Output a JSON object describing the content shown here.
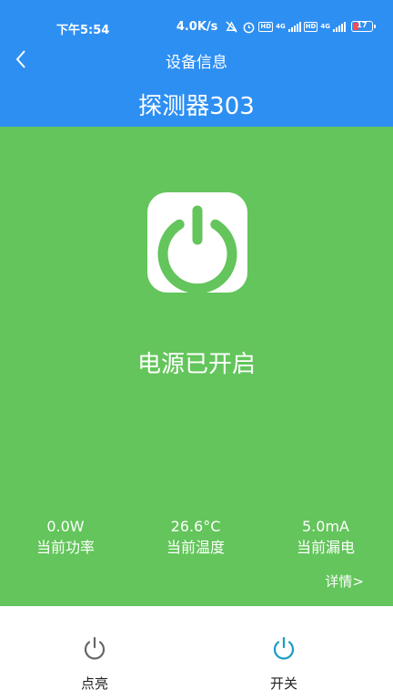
{
  "status_bar": {
    "time": "下午5:54",
    "network_speed": "4.0K/s",
    "battery_level": "17",
    "icons": [
      "mute-icon",
      "alarm-icon",
      "hd-icon",
      "signal-4g-icon",
      "hd-icon",
      "signal-4g-icon",
      "battery-icon"
    ]
  },
  "header": {
    "title": "设备信息",
    "back_icon": "chevron-left-icon"
  },
  "device": {
    "name": "探测器303"
  },
  "power": {
    "icon": "power-icon",
    "status_text": "电源已开启"
  },
  "stats": [
    {
      "value": "0.0W",
      "label": "当前功率"
    },
    {
      "value": "26.6°C",
      "label": "当前温度"
    },
    {
      "value": "5.0mA",
      "label": "当前漏电"
    }
  ],
  "details_link": "详情>",
  "bottom_tabs": [
    {
      "label": "点亮",
      "icon": "power-icon"
    },
    {
      "label": "开关",
      "icon": "power-icon"
    }
  ],
  "colors": {
    "header_bg": "#2e8ff2",
    "main_bg": "#63c55b",
    "tab_inactive": "#666666",
    "tab_active": "#1a9cc4"
  }
}
